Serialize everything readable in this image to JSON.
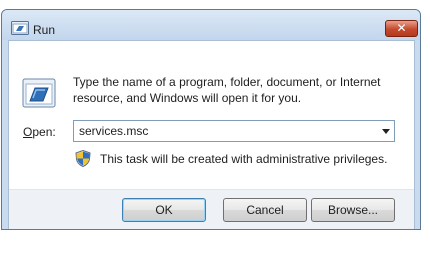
{
  "window": {
    "title": "Run",
    "close_glyph": "✕"
  },
  "dialog": {
    "description_line1": "Type the name of a program, folder, document, or Internet",
    "description_line2": "resource, and Windows will open it for you.",
    "open_label_accel": "O",
    "open_label_rest": "pen:",
    "open_value": "services.msc",
    "admin_note": "This task will be created with administrative privileges.",
    "icons": [
      "run-icon",
      "shield-icon",
      "dropdown-arrow-icon",
      "close-icon"
    ]
  },
  "buttons": {
    "ok": "OK",
    "cancel": "Cancel",
    "browse": "Browse..."
  }
}
